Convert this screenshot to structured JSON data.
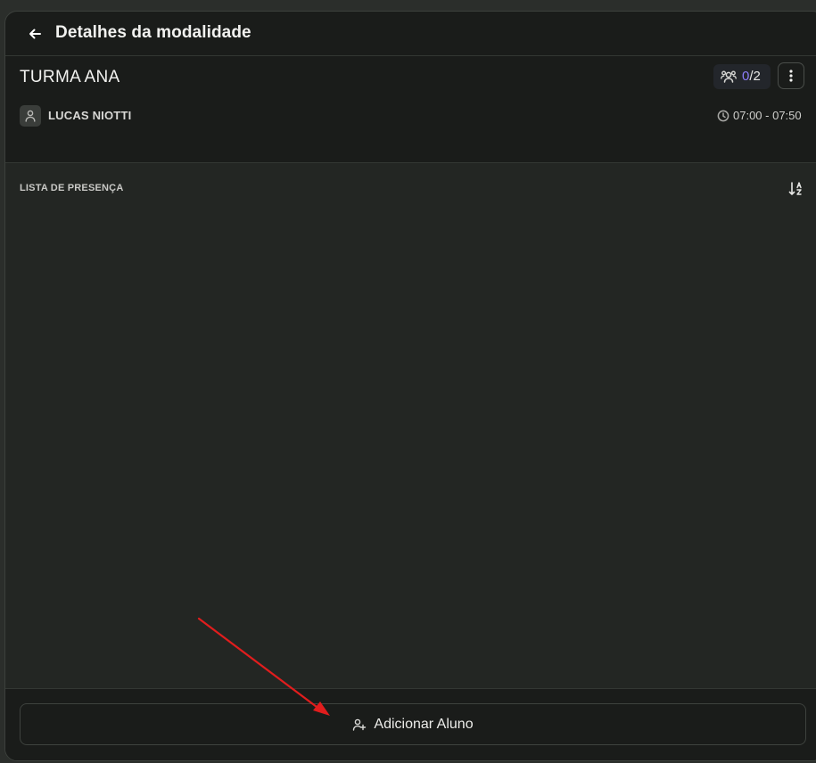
{
  "header": {
    "title": "Detalhes da modalidade",
    "back_icon": "arrow-left-icon"
  },
  "class_info": {
    "name": "TURMA ANA",
    "capacity": {
      "enrolled": "0",
      "separator": "/",
      "total": "2",
      "enrolled_color": "#8b7cf6"
    },
    "teacher": "LUCAS NIOTTI",
    "schedule": "07:00 - 07:50"
  },
  "attendance": {
    "title": "LISTA DE PRESENÇA",
    "sort_icon": "sort-alpha-icon"
  },
  "footer": {
    "add_button_label": "Adicionar Aluno",
    "add_icon": "user-plus-icon"
  },
  "annotation": {
    "color": "#e11d1d"
  }
}
